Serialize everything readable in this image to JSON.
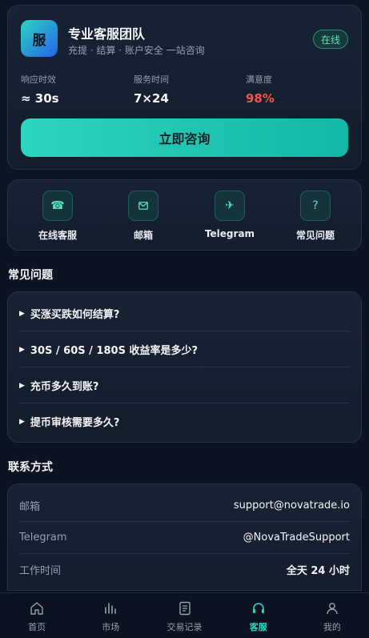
{
  "hero": {
    "logo_char": "服",
    "title": "专业客服团队",
    "subtitle": "充提 · 结算 · 账户安全 一站咨询",
    "badge": "在线",
    "stats": [
      {
        "label": "响应时效",
        "value": "≈ 30s"
      },
      {
        "label": "服务时间",
        "value": "7×24"
      },
      {
        "label": "满意度",
        "value": "98%"
      }
    ],
    "cta_label": "立即咨询"
  },
  "channels": [
    {
      "icon": "phone-icon",
      "label": "在线客服"
    },
    {
      "icon": "mail-icon",
      "label": "邮箱"
    },
    {
      "icon": "telegram-icon",
      "label": "Telegram"
    },
    {
      "icon": "question-icon",
      "label": "常见问题"
    }
  ],
  "faq": {
    "title": "常见问题",
    "items": [
      "买涨买跌如何结算?",
      "30S / 60S / 180S 收益率是多少?",
      "充币多久到账?",
      "提币审核需要多久?"
    ]
  },
  "contact": {
    "title": "联系方式",
    "rows": [
      {
        "label": "邮箱",
        "value": "support@novatrade.io"
      },
      {
        "label": "Telegram",
        "value": "@NovaTradeSupport"
      },
      {
        "label": "工作时间",
        "value": "全天 24 小时"
      }
    ]
  },
  "nav": {
    "items": [
      {
        "icon": "home-icon",
        "label": "首页"
      },
      {
        "icon": "market-icon",
        "label": "市场"
      },
      {
        "icon": "records-icon",
        "label": "交易记录"
      },
      {
        "icon": "headset-icon",
        "label": "客服"
      },
      {
        "icon": "user-icon",
        "label": "我的"
      }
    ],
    "active": "客服"
  },
  "colors": {
    "accent": "#2dd4bf",
    "danger": "#f0564a",
    "background": "#0b1220"
  }
}
